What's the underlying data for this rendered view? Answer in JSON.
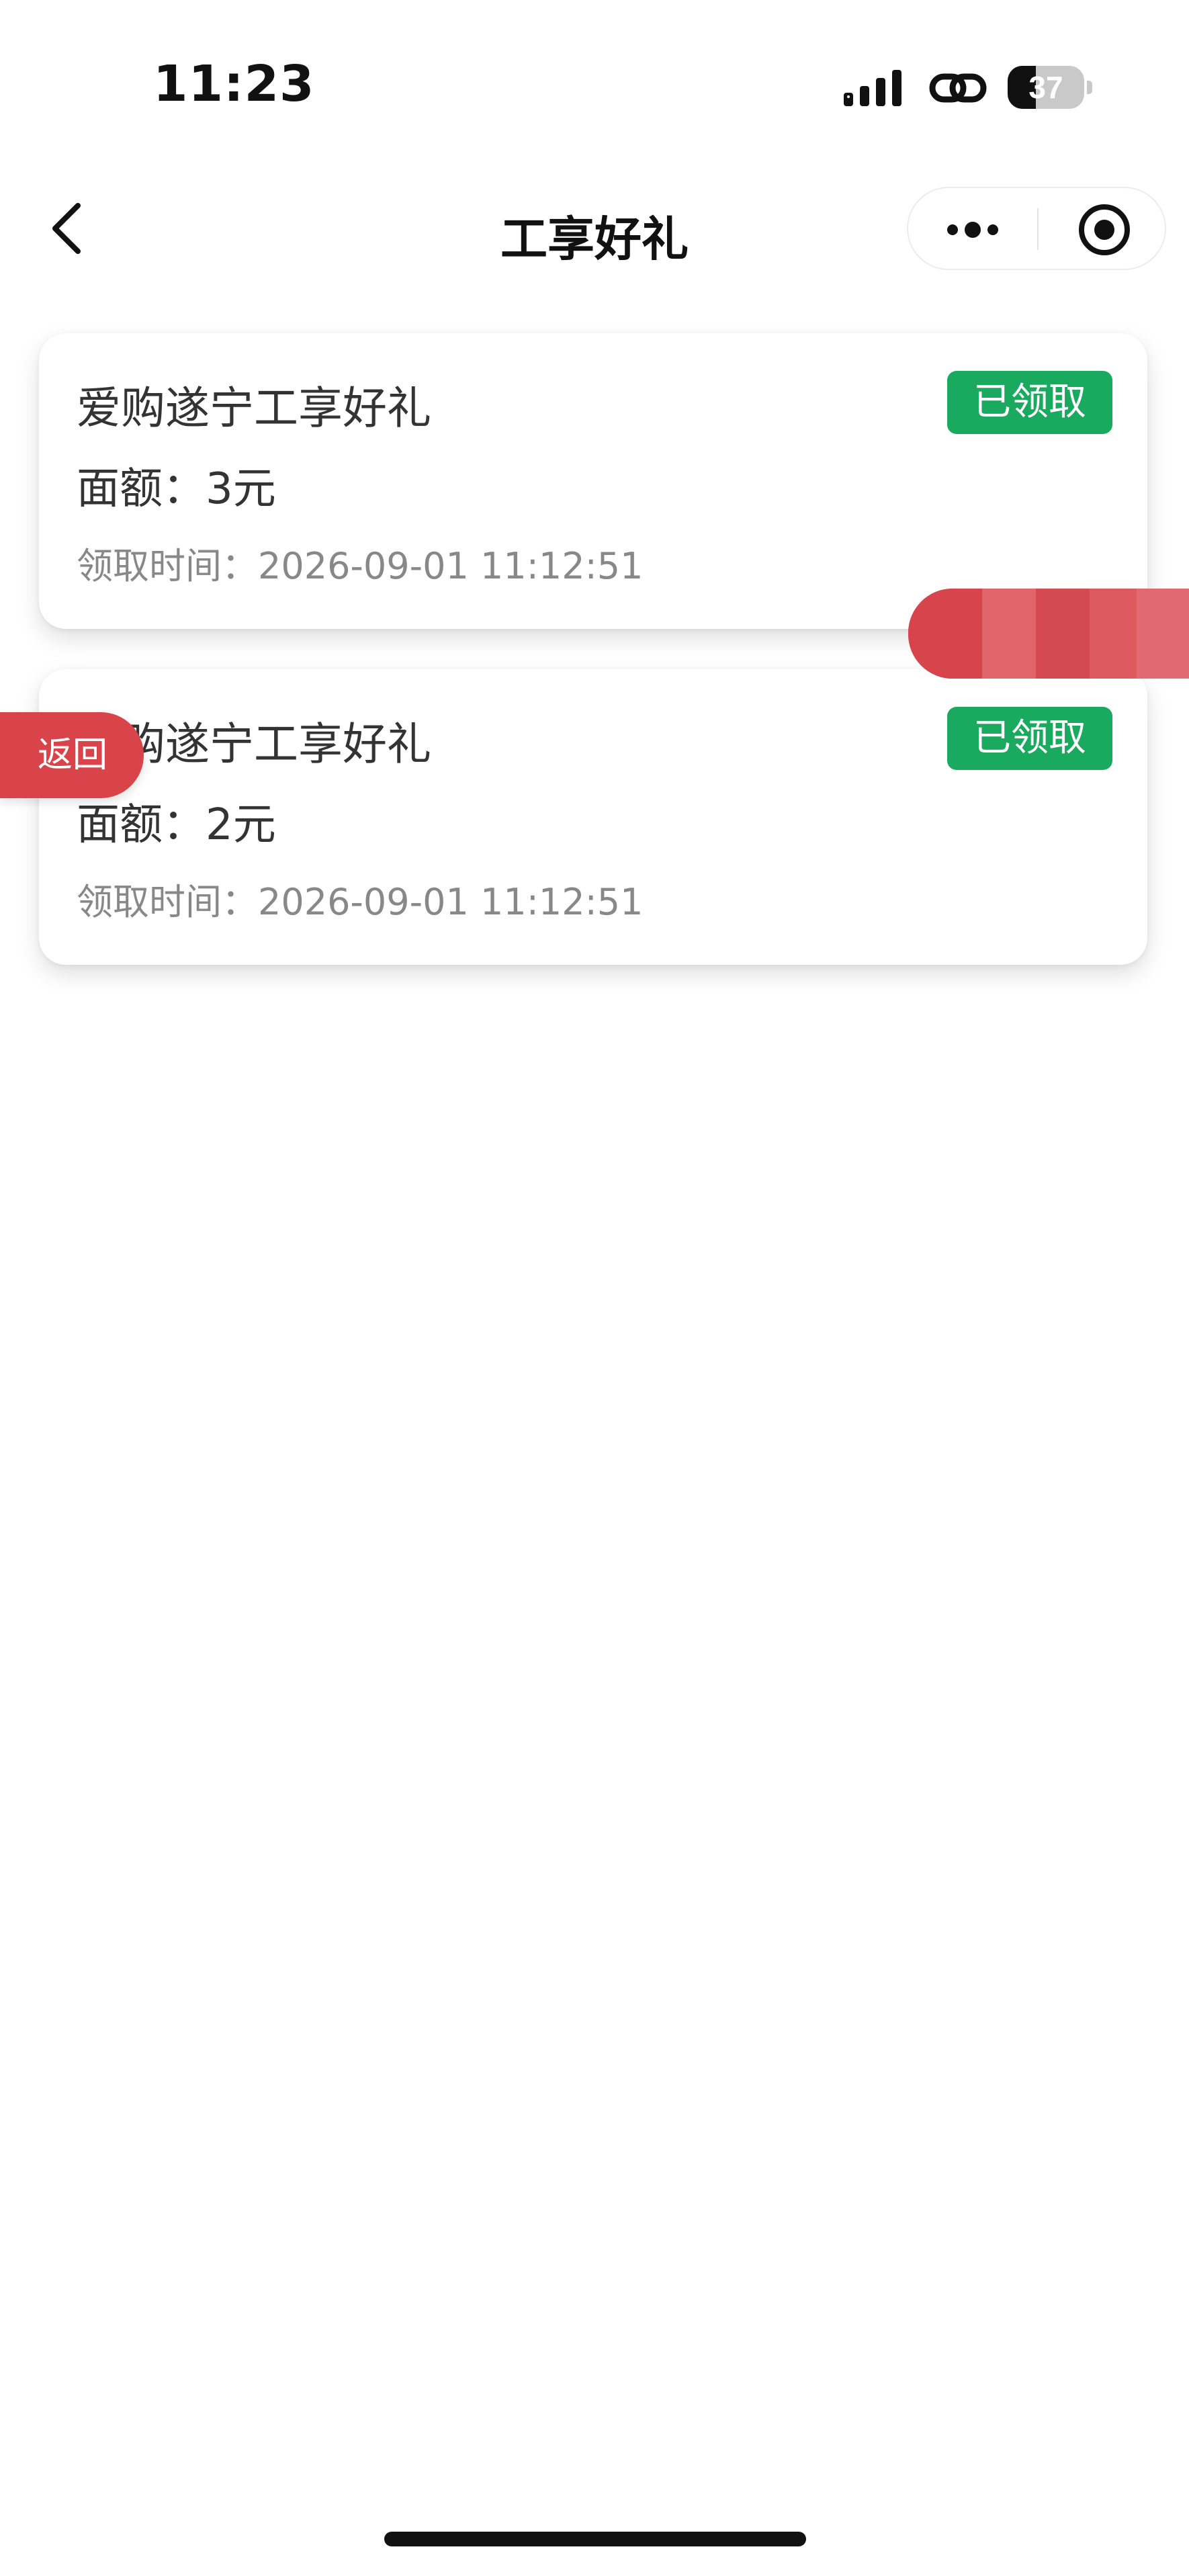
{
  "status_bar": {
    "time": "11:23",
    "battery_level": "37"
  },
  "nav": {
    "title": "工享好礼"
  },
  "coupons": [
    {
      "title": "爱购遂宁工享好礼",
      "amount": "面额：3元",
      "received_time": "领取时间：2026-09-01 11:12:51",
      "status": "已领取"
    },
    {
      "title": "爱购遂宁工享好礼",
      "amount": "面额：2元",
      "received_time": "领取时间：2026-09-01 11:12:51",
      "status": "已领取"
    }
  ],
  "floating": {
    "return_label": "返回"
  },
  "colors": {
    "badge_green": "#1aaa5f",
    "accent_red": "#d9434a"
  },
  "icons": {
    "back": "chevron-left-icon",
    "more": "more-dots-icon",
    "close": "target-circle-icon"
  }
}
